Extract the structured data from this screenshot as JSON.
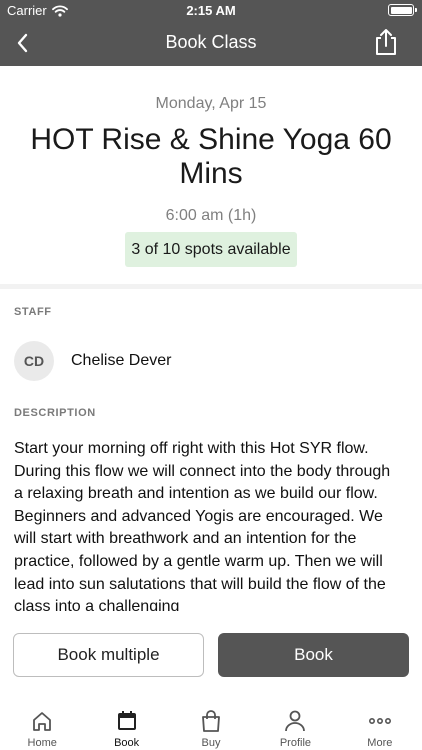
{
  "status_bar": {
    "carrier": "Carrier",
    "time": "2:15 AM"
  },
  "nav": {
    "title": "Book Class"
  },
  "class_info": {
    "date": "Monday, Apr 15",
    "title": "HOT Rise & Shine Yoga 60 Mins",
    "time": "6:00 am (1h)",
    "spots": "3 of 10 spots available"
  },
  "staff": {
    "heading": "STAFF",
    "initials": "CD",
    "name": "Chelise Dever"
  },
  "description": {
    "heading": "DESCRIPTION",
    "text": "Start your morning off right with this Hot SYR flow. During this flow we will connect into the body through a relaxing breath and intention as we build our flow.   Beginners and advanced Yogis are encouraged. We will start with breathwork and an intention for the practice, followed by a gentle warm up.   Then we will lead into sun salutations that will build the flow of the class into a challenging"
  },
  "actions": {
    "multiple": "Book multiple",
    "book": "Book"
  },
  "tabs": [
    {
      "label": "Home",
      "icon": "home-icon"
    },
    {
      "label": "Book",
      "icon": "calendar-icon"
    },
    {
      "label": "Buy",
      "icon": "shopping-bag-icon"
    },
    {
      "label": "Profile",
      "icon": "profile-icon"
    },
    {
      "label": "More",
      "icon": "more-icon"
    }
  ],
  "colors": {
    "header": "#555555",
    "spots_bg": "#dff1df",
    "primary_button": "#555555"
  }
}
